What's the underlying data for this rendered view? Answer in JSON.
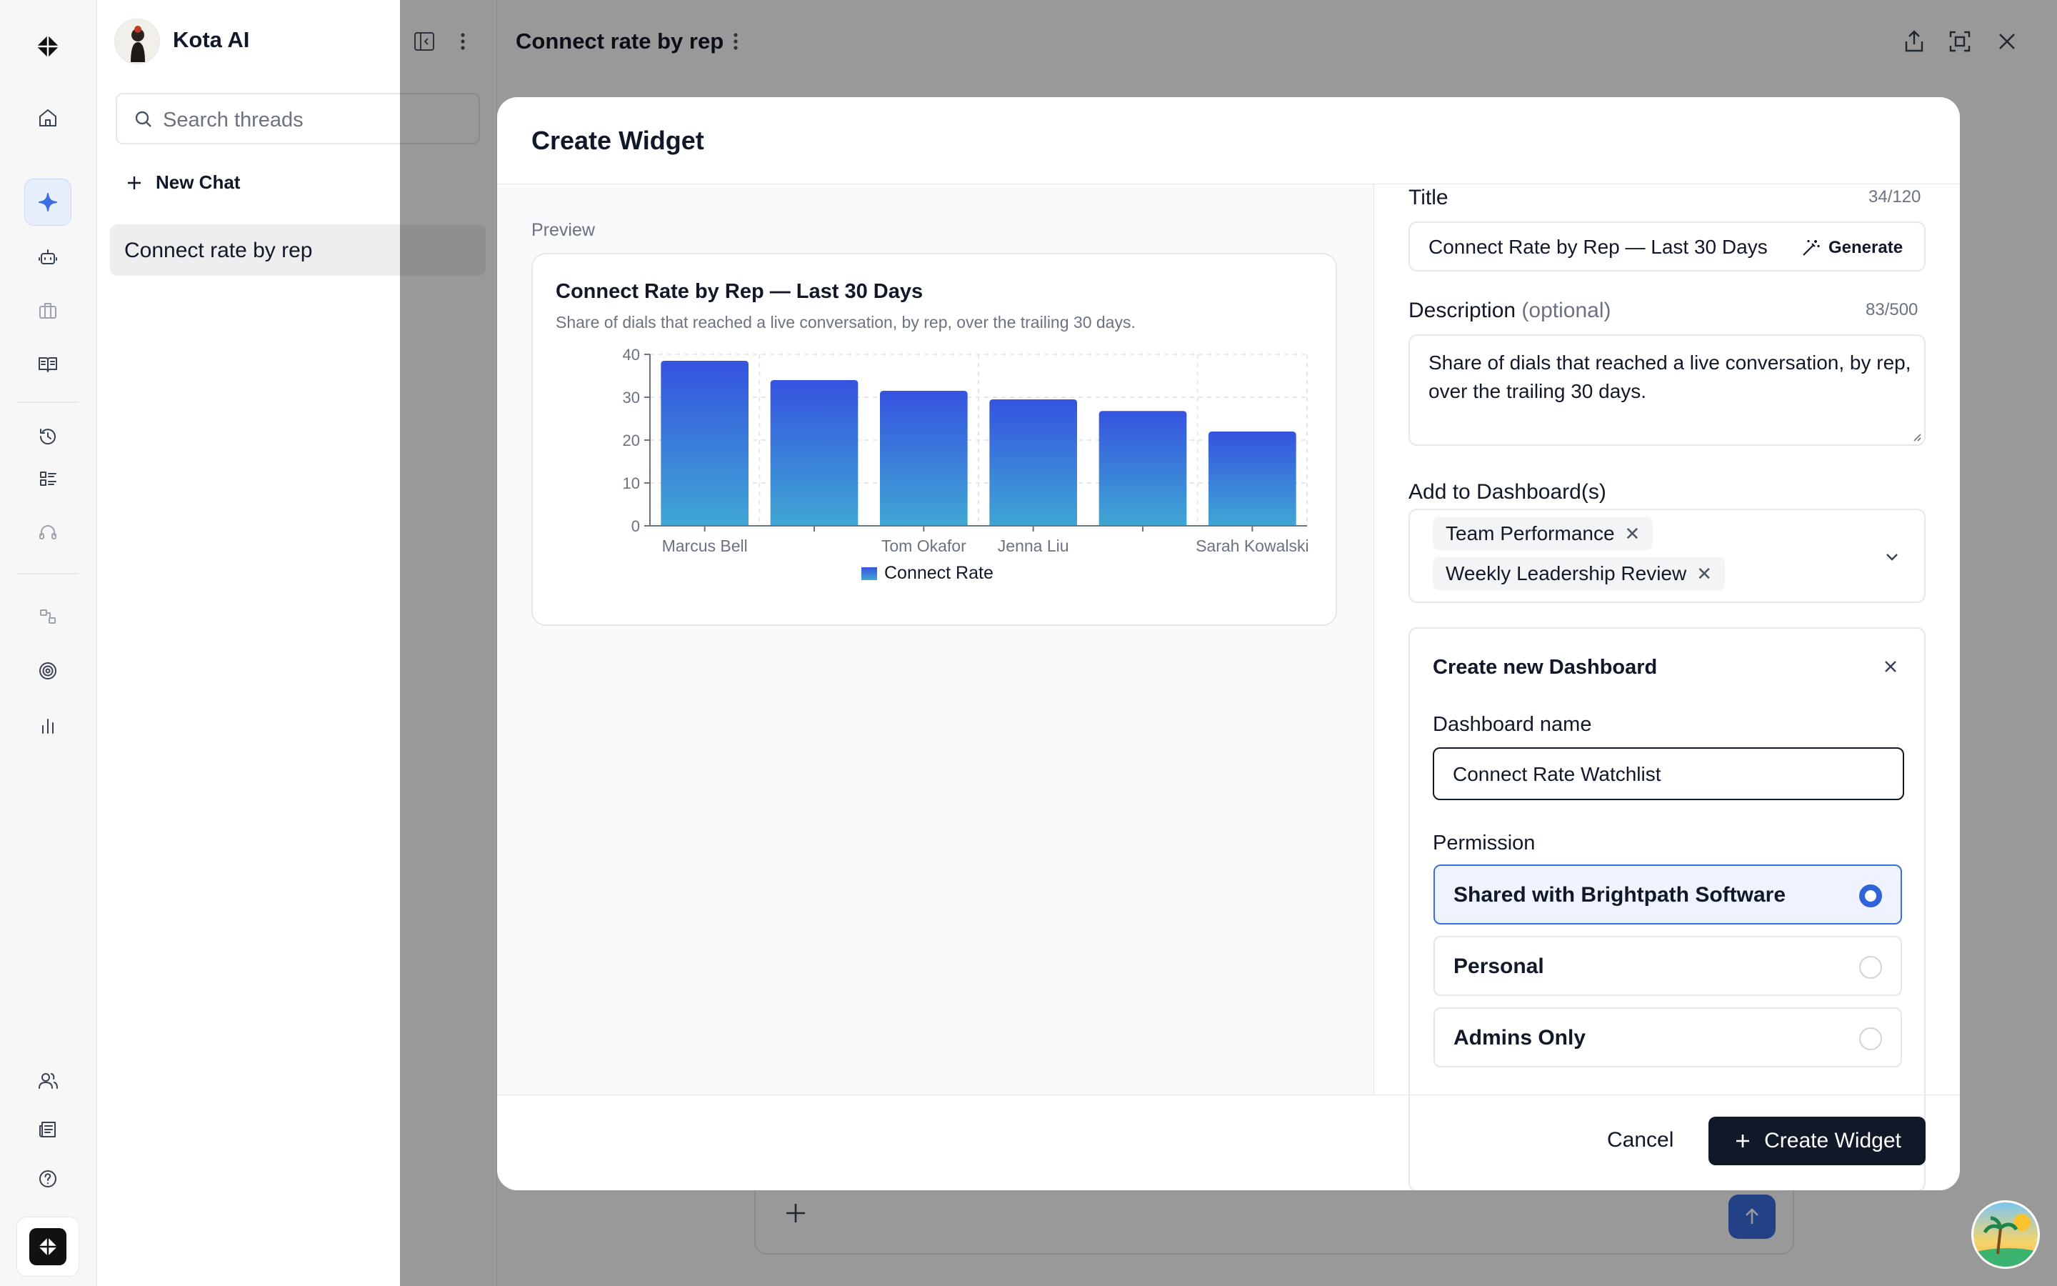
{
  "app": {
    "name": "Kota AI",
    "logo_icon": "diamond-logo-icon"
  },
  "sidebar": {
    "search_placeholder": "Search threads",
    "new_chat_label": "New Chat",
    "threads": [
      {
        "label": "Connect rate by rep",
        "selected": true
      }
    ]
  },
  "header": {
    "title": "Connect rate by rep"
  },
  "modal": {
    "title": "Create Widget",
    "preview_label": "Preview",
    "chart": {
      "title": "Connect Rate by Rep — Last 30 Days",
      "subtitle": "Share of dials that reached a live conversation, by rep, over the trailing 30 days.",
      "legend": "Connect Rate",
      "y_ticks": [
        "0",
        "10",
        "20",
        "30",
        "40"
      ],
      "x_labels": [
        "Marcus Bell",
        "Tom Okafor",
        "Jenna Liu",
        "Sarah Kowalski"
      ]
    },
    "form": {
      "title_label": "Title",
      "title_count": "34/120",
      "title_value": "Connect Rate by Rep — Last 30 Days",
      "generate_label": "Generate",
      "description_label": "Description",
      "description_optional": "(optional)",
      "description_count": "83/500",
      "description_value": "Share of dials that reached a live conversation, by rep, over the trailing 30 days.",
      "dashboards_label": "Add to Dashboard(s)",
      "dashboards": [
        "Team Performance",
        "Weekly Leadership Review"
      ],
      "new_dashboard": {
        "title": "Create new Dashboard",
        "name_label": "Dashboard name",
        "name_value": "Connect Rate Watchlist",
        "permission_label": "Permission",
        "options": [
          {
            "label": "Shared with Brightpath Software",
            "selected": true
          },
          {
            "label": "Personal",
            "selected": false
          },
          {
            "label": "Admins Only",
            "selected": false
          }
        ]
      }
    },
    "footer": {
      "cancel_label": "Cancel",
      "create_label": "Create Widget"
    }
  },
  "colors": {
    "accent": "#3b6fe0",
    "primary_button": "#111827",
    "bar_top": "#3553e0",
    "bar_bottom": "#3fa7d4"
  },
  "chart_data": {
    "type": "bar",
    "title": "Connect Rate by Rep — Last 30 Days",
    "subtitle": "Share of dials that reached a live conversation, by rep, over the trailing 30 days.",
    "categories": [
      "Marcus Bell",
      "",
      "Tom Okafor",
      "Jenna Liu",
      "",
      "Sarah Kowalski"
    ],
    "series": [
      {
        "name": "Connect Rate",
        "values": [
          38.5,
          34,
          31.5,
          29.5,
          26.8,
          22
        ]
      }
    ],
    "ylim": [
      0,
      40
    ],
    "yticks": [
      0,
      10,
      20,
      30,
      40
    ],
    "grid": true,
    "legend": "bottom"
  }
}
